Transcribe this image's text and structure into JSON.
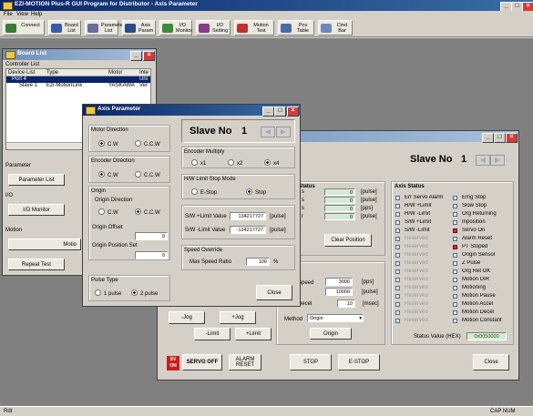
{
  "app": {
    "title": "EZI-MOTION Plus-R GUI Program for Distributor - Axis Parameter"
  },
  "menu": [
    "File",
    "View",
    "Help"
  ],
  "toolbar": [
    {
      "label": "Connect",
      "icon": "connect-icon",
      "color": "#3c7a3c"
    },
    {
      "label": "Board List",
      "icon": "board-list-icon",
      "color": "#3a5aa8"
    },
    {
      "label": "Parameter List",
      "icon": "parameter-list-icon",
      "color": "#6a6a9a"
    },
    {
      "label": "Axis Param",
      "icon": "axis-param-icon",
      "color": "#2a4a8a"
    },
    {
      "label": "I/O Monitor",
      "icon": "io-monitor-icon",
      "color": "#3a8a3a"
    },
    {
      "label": "I/O Setting",
      "icon": "io-setting-icon",
      "color": "#8a3a8a"
    },
    {
      "label": "Motion Test",
      "icon": "motion-test-icon",
      "color": "#c03030"
    },
    {
      "label": "Pos Table",
      "icon": "pos-table-icon",
      "color": "#4a6aa8"
    },
    {
      "label": "Cmd Bar",
      "icon": "cmd-bar-icon",
      "color": "#6a8ab8"
    }
  ],
  "board_list": {
    "title": "Board List",
    "controller_list": "Controller List",
    "columns": [
      "Device List",
      "Type",
      "Motor",
      "Inte"
    ],
    "port_row": {
      "device": "Port 4",
      "type": "",
      "motor": "",
      "inte": "Uni"
    },
    "slave_row": {
      "device": "Slave 1",
      "type": "Ezi-MotionLink",
      "motor": "YASKAWA",
      "inte": "Ver"
    },
    "parameter_section": "Parameter",
    "parameter_button": "Parameter List",
    "io_section": "I/O",
    "io_button": "I/O Monitor",
    "motion_section": "Motion",
    "motion_button": "Motio",
    "repeat_button": "Repeat Test"
  },
  "motion_window": {
    "slave_label": "Slave No",
    "slave_no": "1",
    "axis_status_title": "Axis Status",
    "status_left_title": "n Status",
    "status_rows": [
      {
        "label": "s",
        "value": "0",
        "unit": "[pulse]"
      },
      {
        "label": "s",
        "value": "0",
        "unit": "[pulse]"
      },
      {
        "label": "s",
        "value": "0",
        "unit": "[pps]"
      },
      {
        "label": "r",
        "value": "0",
        "unit": "[pulse]"
      }
    ],
    "clear_position": "Clear Position",
    "speed_label": "Speed",
    "speed_value": "3000",
    "speed_unit": "[pps]",
    "position_value": "10000",
    "position_unit": "[pulse]",
    "decel_label": "Decel",
    "decel_value": "10",
    "decel_unit": "[msec]",
    "method_label": "Method",
    "method_value": "Origin",
    "origin_button": "Origin",
    "jog_minus": "-Jog",
    "jog_plus": "+Jog",
    "limit_minus": "-Limit",
    "limit_plus": "+Limit",
    "sv_on_icon_text": "SV ON",
    "servo_off": "SERVO OFF",
    "alarm_reset": "ALARM RESET",
    "stop": "STOP",
    "estop": "E-STOP",
    "close": "Close",
    "status_value_label": "Status Value (HEX)",
    "status_value": "0x0050000",
    "flags_left": [
      {
        "label": "Err Servo Alarm",
        "on": false
      },
      {
        "label": "H/W +Limit",
        "on": false
      },
      {
        "label": "H/W -Limit",
        "on": false
      },
      {
        "label": "S/W +Limit",
        "on": false
      },
      {
        "label": "S/W -Limit",
        "on": false
      },
      {
        "label": "Reserved",
        "on": false
      },
      {
        "label": "Reserved",
        "on": false
      },
      {
        "label": "Reserved",
        "on": false
      },
      {
        "label": "Reserved",
        "on": false
      },
      {
        "label": "Reserved",
        "on": false
      },
      {
        "label": "Reserved",
        "on": false
      },
      {
        "label": "Reserved",
        "on": false
      },
      {
        "label": "Reserved",
        "on": false
      },
      {
        "label": "Reserved",
        "on": false
      },
      {
        "label": "Reserved",
        "on": false
      },
      {
        "label": "Reserved",
        "on": false
      }
    ],
    "flags_right": [
      {
        "label": "Emg Stop",
        "on": false
      },
      {
        "label": "Slow Stop",
        "on": false
      },
      {
        "label": "Org Returning",
        "on": false
      },
      {
        "label": "Inposition",
        "on": false
      },
      {
        "label": "Servo On",
        "on": true
      },
      {
        "label": "Alarm Reset",
        "on": false
      },
      {
        "label": "PT Stoped",
        "on": true
      },
      {
        "label": "Origin Sensor",
        "on": false
      },
      {
        "label": "Z Pulse",
        "on": false
      },
      {
        "label": "Org Ret OK",
        "on": false
      },
      {
        "label": "Motion DIR",
        "on": false
      },
      {
        "label": "Motioning",
        "on": false
      },
      {
        "label": "Motion Pause",
        "on": false
      },
      {
        "label": "Motion Accel",
        "on": false
      },
      {
        "label": "Motion Decel",
        "on": false
      },
      {
        "label": "Motion Constant",
        "on": false
      }
    ]
  },
  "axis_param": {
    "title": "Axis Parameter",
    "slave_label": "Slave No",
    "slave_no": "1",
    "motor_direction": {
      "title": "Motor Direction",
      "options": [
        "C.W",
        "C.C.W"
      ],
      "selected": 0
    },
    "encoder_direction": {
      "title": "Encoder Direction",
      "options": [
        "C.W",
        "C.C.W"
      ],
      "selected": 0
    },
    "origin": {
      "title": "Origin",
      "direction_title": "Origin Direction",
      "options": [
        "C.W",
        "C.C.W"
      ],
      "selected": 1,
      "offset_label": "Origin Offset",
      "offset_value": "0",
      "position_set_label": "Origin Position Set",
      "position_set_value": "0"
    },
    "pulse_type": {
      "title": "Pulse Type",
      "options": [
        "1 pulse",
        "2 pulse"
      ],
      "selected": 1
    },
    "encoder_multiply": {
      "title": "Encoder Multiply",
      "options": [
        "x1",
        "x2",
        "x4"
      ],
      "selected": 2
    },
    "hw_limit": {
      "title": "H/W Limit Stop Mode",
      "options": [
        "E-Stop",
        "Stop"
      ],
      "selected": 1
    },
    "sw_plus": {
      "label": "S/W +Limit Value",
      "value": "134217727",
      "unit": "[pulse]"
    },
    "sw_minus": {
      "label": "S/W -Limit Value",
      "value": "-134217727",
      "unit": "[pulse]"
    },
    "speed_override": {
      "title": "Speed Override",
      "label": "Max Speed Ratio",
      "value": "100",
      "unit": "%"
    },
    "close": "Close"
  },
  "statusbar": {
    "left": "Rdt",
    "right": "CAP  NUM"
  }
}
